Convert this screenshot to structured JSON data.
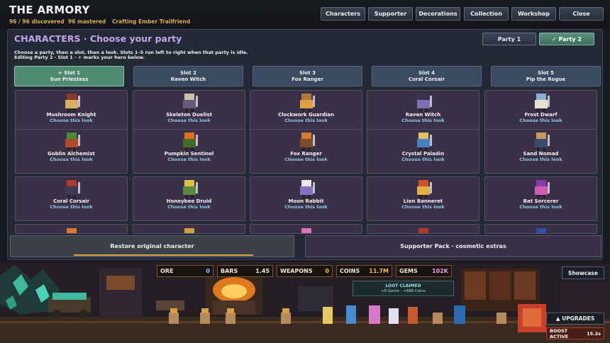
{
  "header": {
    "title": "THE ARMORY",
    "discovered": "96 / 96 discovered",
    "mastered": "96 mastered",
    "crafting": "Crafting Ember Trailfriend",
    "nav": [
      "Characters",
      "Supporter",
      "Decorations",
      "Collection",
      "Workshop",
      "Close"
    ]
  },
  "panel": {
    "title": "CHARACTERS · Choose your party",
    "party_tabs": [
      {
        "label": "Party 1",
        "selected": false
      },
      {
        "label": "✓ Party 2",
        "selected": true
      }
    ],
    "instructions_1": "Choose a party, then a slot, then a look. Slots 1–5 run left to right when that party is idle.",
    "instructions_2": "Editing Party 2 · Slot 1 · + marks your hero below.",
    "slots": [
      {
        "label": "+ Slot 1",
        "name": "Sun Priestess",
        "active": true
      },
      {
        "label": "Slot 2",
        "name": "Raven Witch",
        "active": false
      },
      {
        "label": "Slot 3",
        "name": "Fox Ranger",
        "active": false
      },
      {
        "label": "Slot 4",
        "name": "Coral Corsair",
        "active": false
      },
      {
        "label": "Slot 5",
        "name": "Pip the Rogue",
        "active": false
      }
    ],
    "choose_label": "Choose this look",
    "looks": [
      "Mushroom Knight",
      "Skeleton Duelist",
      "Clockwork Guardian",
      "Raven Witch",
      "Frost Dwarf",
      "Goblin Alchemist",
      "Pumpkin Sentinel",
      "Fox Ranger",
      "Crystal Paladin",
      "Sand Nomad",
      "Coral Corsair",
      "Honeybee Druid",
      "Moon Rabbit",
      "Lion Banneret",
      "Bat Sorcerer"
    ],
    "restore_label": "Restore original character",
    "supporter_label": "Supporter Pack · cosmetic extras"
  },
  "resources": [
    {
      "label": "ORE",
      "value": "0"
    },
    {
      "label": "BARS",
      "value": "1.45"
    },
    {
      "label": "WEAPONS",
      "value": "0"
    },
    {
      "label": "COINS",
      "value": "11.7M"
    },
    {
      "label": "GEMS",
      "value": "102K"
    }
  ],
  "scene": {
    "showcase": "Showcase",
    "loot_title": "LOOT CLAIMED",
    "loot_detail": "+6 Gems · +686 Coins",
    "upgrades": "▲ UPGRADES",
    "boost_label": "BOOST ACTIVE",
    "boost_time": "15.2s"
  },
  "colors": {
    "accent_purple": "#c3a4ee",
    "active_green": "#4f8a72",
    "slot_blue": "#3a4b61",
    "card_purple": "#3a3148",
    "gold": "#f3c24f"
  }
}
